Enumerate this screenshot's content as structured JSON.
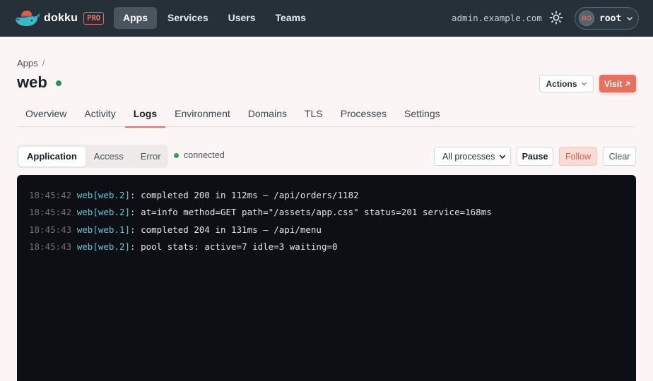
{
  "topbar": {
    "brand": "dokku",
    "badge": "PRO",
    "nav": [
      {
        "label": "Apps",
        "active": true
      },
      {
        "label": "Services",
        "active": false
      },
      {
        "label": "Users",
        "active": false
      },
      {
        "label": "Teams",
        "active": false
      }
    ],
    "host": "admin.example.com",
    "theme_icon": "sun-icon",
    "user": {
      "initials": "RO",
      "name": "root"
    }
  },
  "breadcrumb": {
    "root": "Apps",
    "separator": "/"
  },
  "app": {
    "name": "web",
    "status_color": "#2f8f5b"
  },
  "header_actions": {
    "actions_label": "Actions",
    "visit_label": "Visit",
    "visit_icon": "external-link-icon"
  },
  "tabs": [
    {
      "label": "Overview",
      "active": false
    },
    {
      "label": "Activity",
      "active": false
    },
    {
      "label": "Logs",
      "active": true
    },
    {
      "label": "Environment",
      "active": false
    },
    {
      "label": "Domains",
      "active": false
    },
    {
      "label": "TLS",
      "active": false
    },
    {
      "label": "Processes",
      "active": false
    },
    {
      "label": "Settings",
      "active": false
    }
  ],
  "log_controls": {
    "types": [
      {
        "label": "Application",
        "active": true
      },
      {
        "label": "Access",
        "active": false
      },
      {
        "label": "Error",
        "active": false
      }
    ],
    "connection_status": "connected",
    "process_filter": "All processes",
    "pause_label": "Pause",
    "follow_label": "Follow",
    "clear_label": "Clear"
  },
  "logs": [
    {
      "time": "18:45:42",
      "source": "web[web.2]",
      "message": ": completed 200 in 112ms — /api/orders/1182"
    },
    {
      "time": "18:45:42",
      "source": "web[web.2]",
      "message": ": at=info method=GET path=\"/assets/app.css\" status=201 service=168ms"
    },
    {
      "time": "18:45:43",
      "source": "web[web.1]",
      "message": ": completed 204 in 131ms — /api/menu"
    },
    {
      "time": "18:45:43",
      "source": "web[web.2]",
      "message": ": pool stats: active=7 idle=3 waiting=0"
    }
  ],
  "colors": {
    "accent": "#e8705f",
    "topbar": "#253038",
    "log_bg": "#0d0f14",
    "log_source": "#5ec9d8"
  }
}
